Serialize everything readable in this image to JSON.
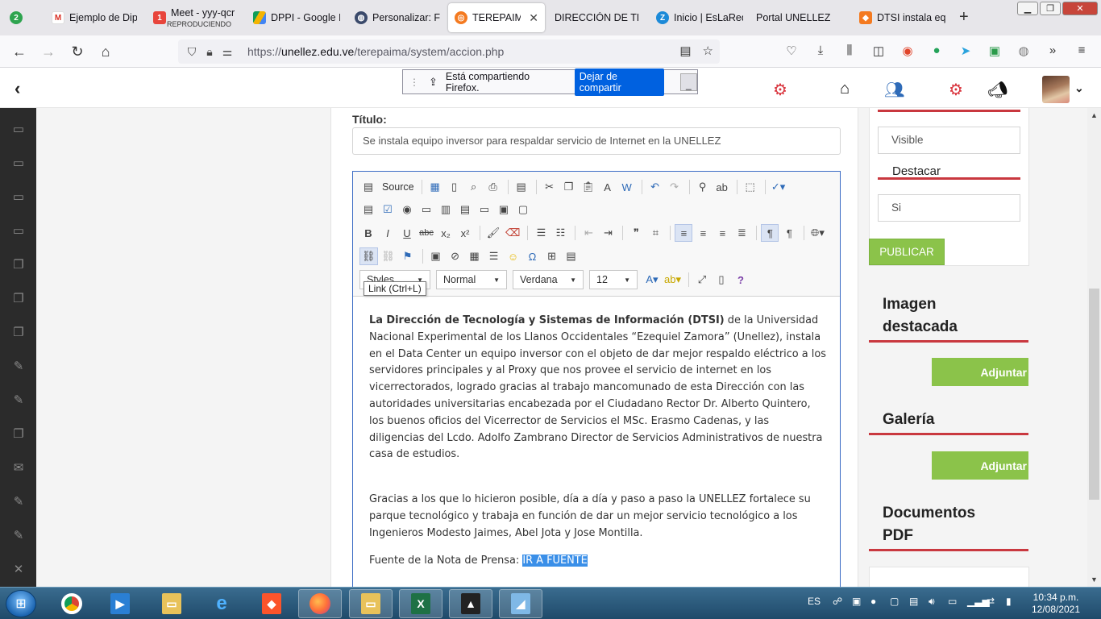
{
  "browser": {
    "tabs": [
      {
        "label": "",
        "badge": "2"
      },
      {
        "label": "Ejemplo de Dip"
      },
      {
        "label": "Meet - yyy-qcr",
        "sub": "REPRODUCIENDO"
      },
      {
        "label": "DPPI - Google D"
      },
      {
        "label": "Personalizar: Fu"
      },
      {
        "label": "TERPAIMA"
      },
      {
        "label": "DIRECCIÓN DE TEC"
      },
      {
        "label": "Inicio | EsLaRed"
      },
      {
        "label": "Portal UNELLEZ"
      },
      {
        "label": "DTSI instala equ"
      }
    ],
    "active_tab_label": "TEREPAIMA |",
    "url_prefix": "https://",
    "url_host": "unellez.edu.ve",
    "url_path": "/terepaima/system/accion.php"
  },
  "sharing": {
    "message": "Está compartiendo Firefox.",
    "stop_label": "Dejar de compartir"
  },
  "form": {
    "title_label": "Título:",
    "title_value": "Se instala equipo inversor para respaldar servicio de Internet en la UNELLEZ"
  },
  "editor": {
    "source_label": "Source",
    "styles_label": "Styles",
    "format_value": "Normal",
    "font_value": "Verdana",
    "size_value": "12",
    "tooltip": "Link (Ctrl+L)",
    "p1_bold": "La Dirección de Tecnología y  Sistemas de Información (DTSI)",
    "p1_rest": " de la Universidad Nacional  Experimental de los Llanos Occidentales “Ezequiel Zamora”  (Unellez), instala en el Data Center un equipo inversor con el objeto de dar mejor respaldo eléctrico a los servidores principales y al Proxy que nos provee el servicio de internet en los vicerrectorados,   logrado gracias al trabajo mancomunado de esta Dirección con las autoridades universitarias  encabezada  por el Ciudadano Rector Dr. Alberto Quintero, los buenos oficios del Vicerrector de Servicios el MSc. Erasmo Cadenas, y las diligencias del Lcdo. Adolfo Zambrano  Director de Servicios Administrativos  de nuestra casa de estudios.",
    "p2": "Gracias a los que lo hicieron posible, día a día y paso a paso  la UNELLEZ fortalece su parque tecnológico y trabaja en función de dar un mejor servicio tecnológico a los Ingenieros Modesto Jaimes, Abel Jota y Jose Montilla.",
    "p3_prefix": "Fuente de la Nota de Prensa: ",
    "p3_link": "IR A FUENTE"
  },
  "sidebar": {
    "visible_value": "Visible",
    "destacar_label": "Destacar",
    "destacar_value": "Si",
    "publish_label": "PUBLICAR",
    "imagen_heading": "Imagen destacada",
    "galeria_heading": "Galería",
    "documentos_heading": "Documentos PDF",
    "attach_label": "Adjuntar"
  },
  "taskbar": {
    "lang": "ES",
    "time": "10:34 p.m.",
    "date": "12/08/2021"
  },
  "colors": {
    "accent_red": "#c9383f",
    "publish_green": "#8bc34a",
    "editor_border": "#3a6bc4",
    "share_button": "#0061e0"
  }
}
